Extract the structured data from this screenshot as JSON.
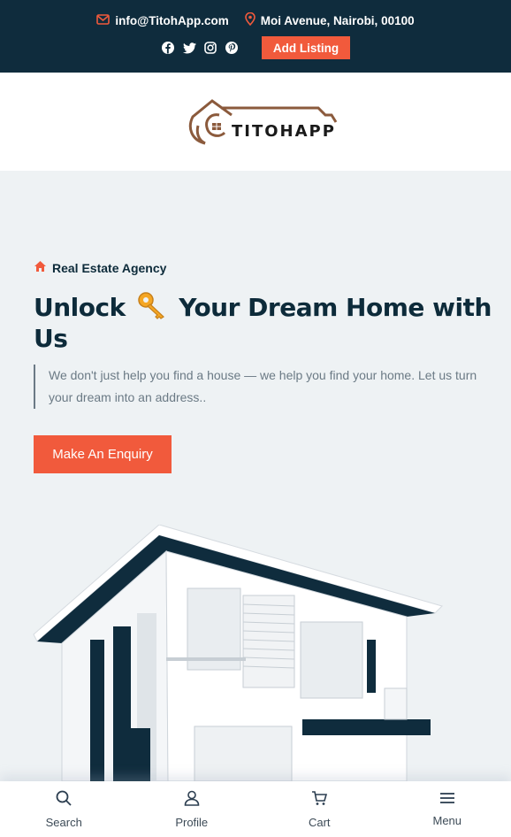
{
  "topbar": {
    "email": "info@TitohApp.com",
    "address": "Moi Avenue, Nairobi, 00100",
    "add_listing": "Add Listing",
    "socials": [
      "facebook-icon",
      "twitter-icon",
      "instagram-icon",
      "pinterest-icon"
    ]
  },
  "brand": {
    "name": "TITOHAPP"
  },
  "hero": {
    "tag": "Real Estate Agency",
    "headline_part1": "Unlock",
    "headline_part2": "Your Dream Home with Us",
    "lead": "We don't just help you find a house — we help you find your home. Let us turn your dream into an address..",
    "cta": "Make An Enquiry"
  },
  "bottom_nav": [
    {
      "label": "Search",
      "icon": "search-icon"
    },
    {
      "label": "Profile",
      "icon": "user-icon"
    },
    {
      "label": "Cart",
      "icon": "cart-icon"
    },
    {
      "label": "Menu",
      "icon": "menu-icon"
    }
  ],
  "colors": {
    "navy": "#0f2c3d",
    "accent": "#f15a3c",
    "background": "#eef2f4"
  }
}
